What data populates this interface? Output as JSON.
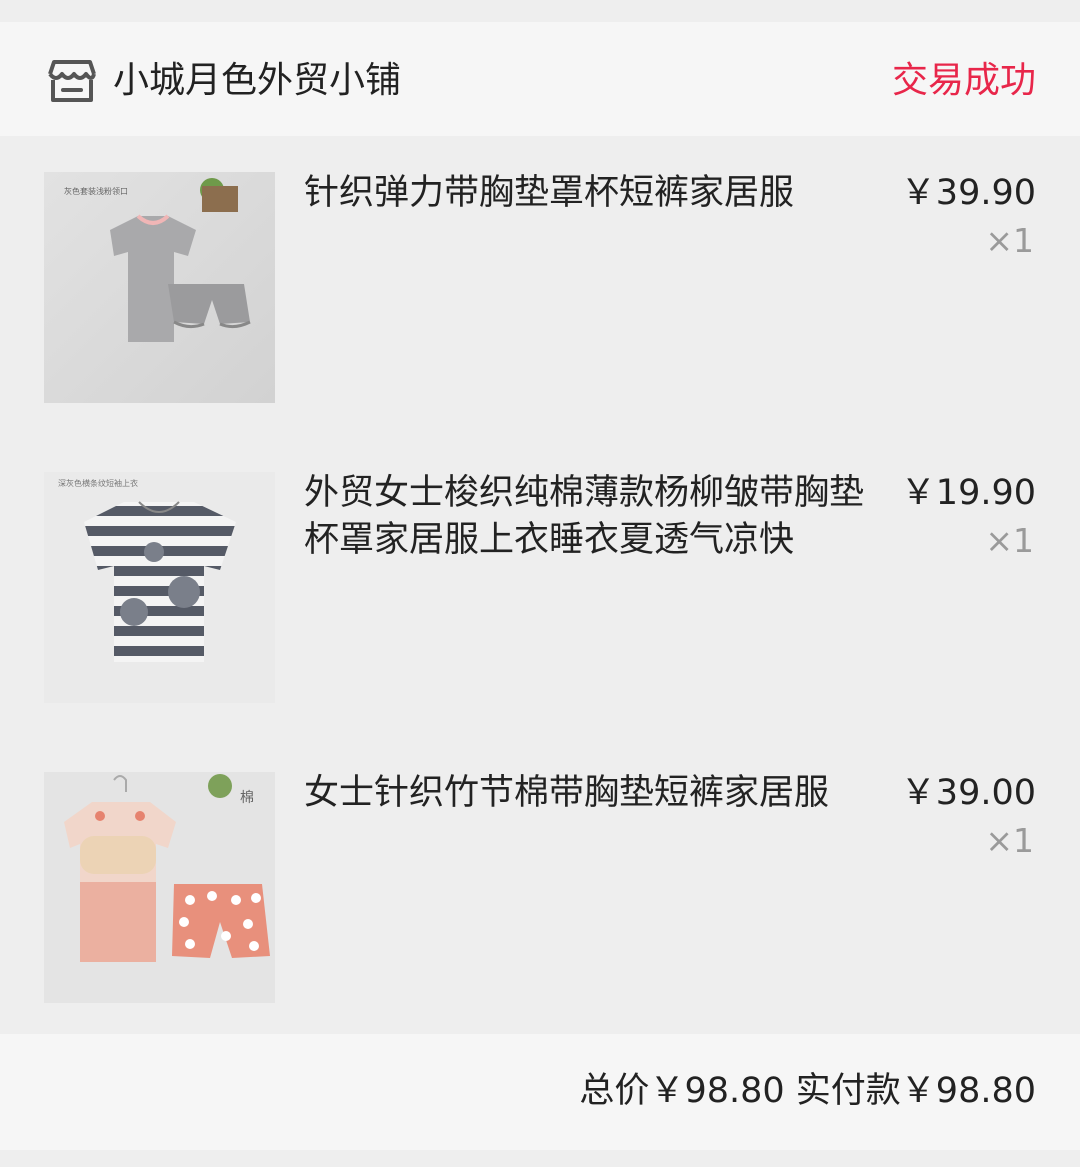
{
  "header": {
    "shop_icon": "store-icon",
    "shop_name": "小城月色外贸小铺",
    "order_status": "交易成功",
    "status_color": "#e8264a"
  },
  "items": [
    {
      "title": "针织弹力带胸垫罩杯短裤家居服",
      "price": "￥39.90",
      "qty": "×1",
      "image_caption": "灰色套装浅粉领口"
    },
    {
      "title": "外贸女士梭织纯棉薄款杨柳皱带胸垫杯罩家居服上衣睡衣夏透气凉快",
      "price": "￥19.90",
      "qty": "×1",
      "image_caption": "深灰色横条纹短袖上衣"
    },
    {
      "title": "女士针织竹节棉带胸垫短裤家居服",
      "price": "￥39.00",
      "qty": "×1",
      "image_caption": "棉"
    }
  ],
  "footer": {
    "total_label": "总价",
    "total_value": "￥98.80",
    "paid_label": "实付款",
    "paid_value": "￥98.80"
  }
}
